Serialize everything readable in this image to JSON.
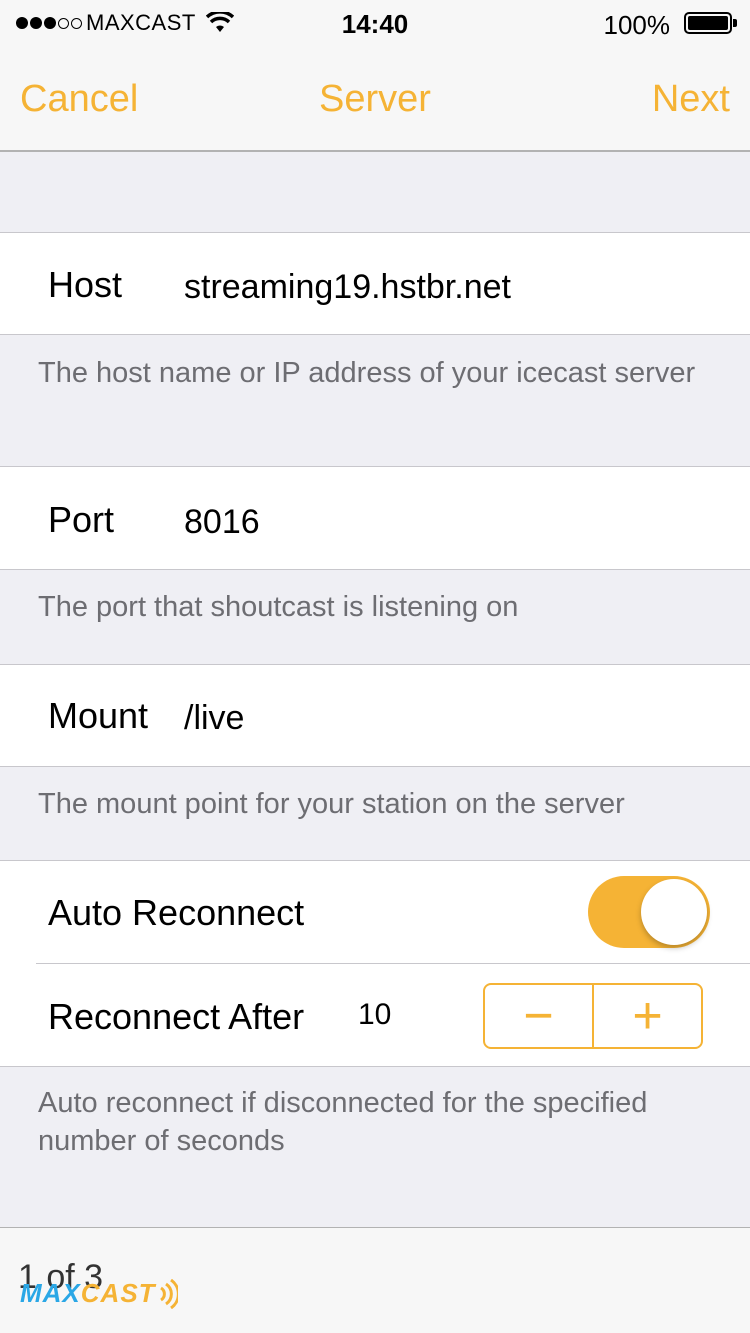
{
  "status_bar": {
    "carrier": "MAXCAST",
    "time": "14:40",
    "battery": "100%"
  },
  "nav": {
    "cancel": "Cancel",
    "title": "Server",
    "next": "Next"
  },
  "host": {
    "label": "Host",
    "value": "streaming19.hstbr.net",
    "footer": "The host name or IP address of your icecast server"
  },
  "port": {
    "label": "Port",
    "value": "8016",
    "footer": "The port that shoutcast is listening on"
  },
  "mount": {
    "label": "Mount",
    "value": "/live",
    "footer": "The mount point for your station on the server"
  },
  "auto_reconnect": {
    "label": "Auto Reconnect",
    "enabled": true
  },
  "reconnect_after": {
    "label": "Reconnect After",
    "value": "10",
    "minus": "−",
    "plus": "+",
    "footer": "Auto reconnect if disconnected for the specified number of seconds"
  },
  "toolbar": {
    "page_indicator": "1 of 3",
    "logo_part1": "MAX",
    "logo_part2": "CAST"
  },
  "colors": {
    "accent": "#f5b335",
    "logo_blue": "#2aa7e6"
  }
}
